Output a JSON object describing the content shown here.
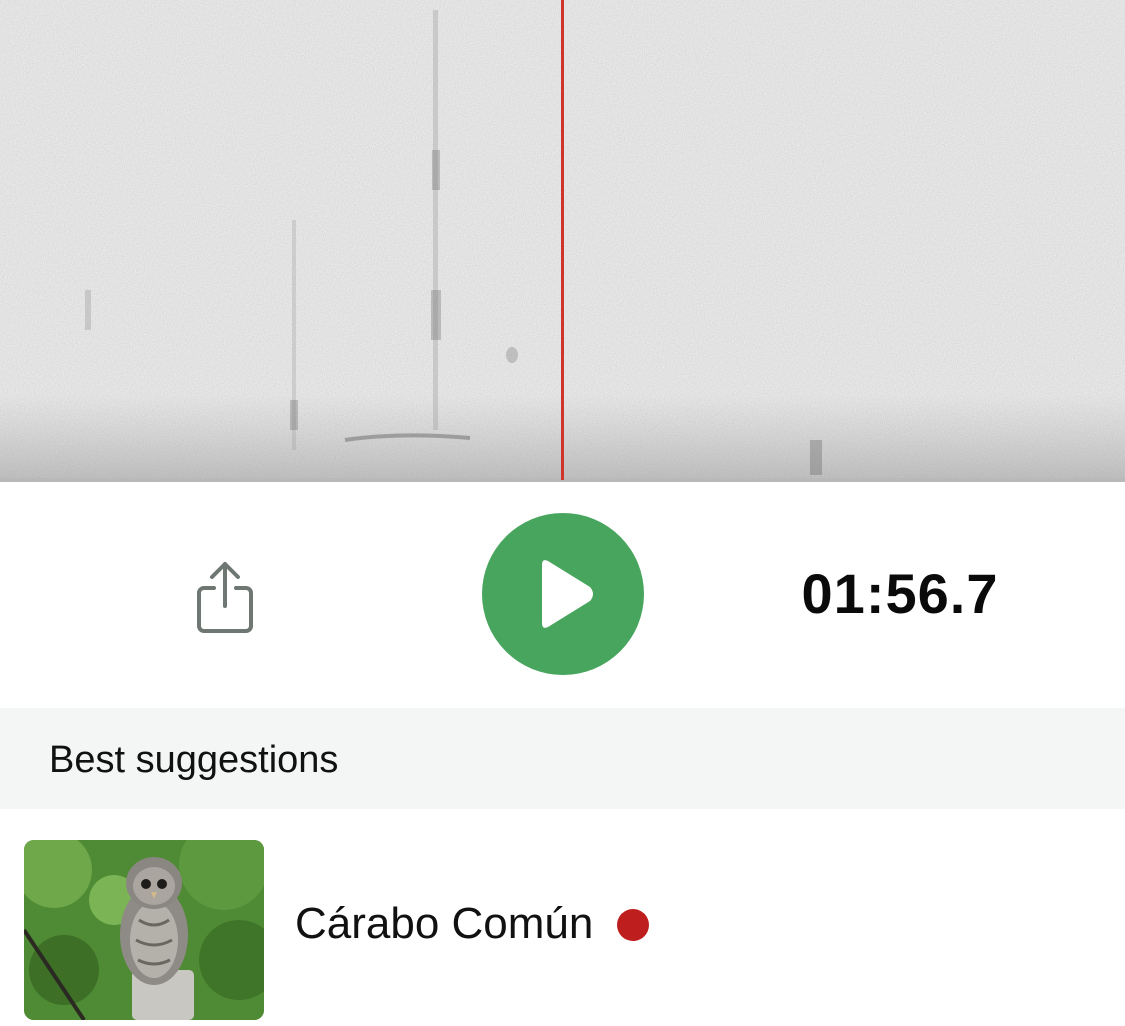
{
  "player": {
    "time": "01:56.7",
    "play_label": "Play",
    "share_label": "Share"
  },
  "suggestions": {
    "title": "Best suggestions",
    "items": [
      {
        "name": "Cárabo Común",
        "status_color": "#be1e1e"
      }
    ]
  },
  "colors": {
    "accent": "#47a55d",
    "playhead": "#d0342c",
    "status": "#be1e1e"
  },
  "icons": {
    "share": "share-icon",
    "play": "play-icon",
    "status": "status-dot"
  }
}
